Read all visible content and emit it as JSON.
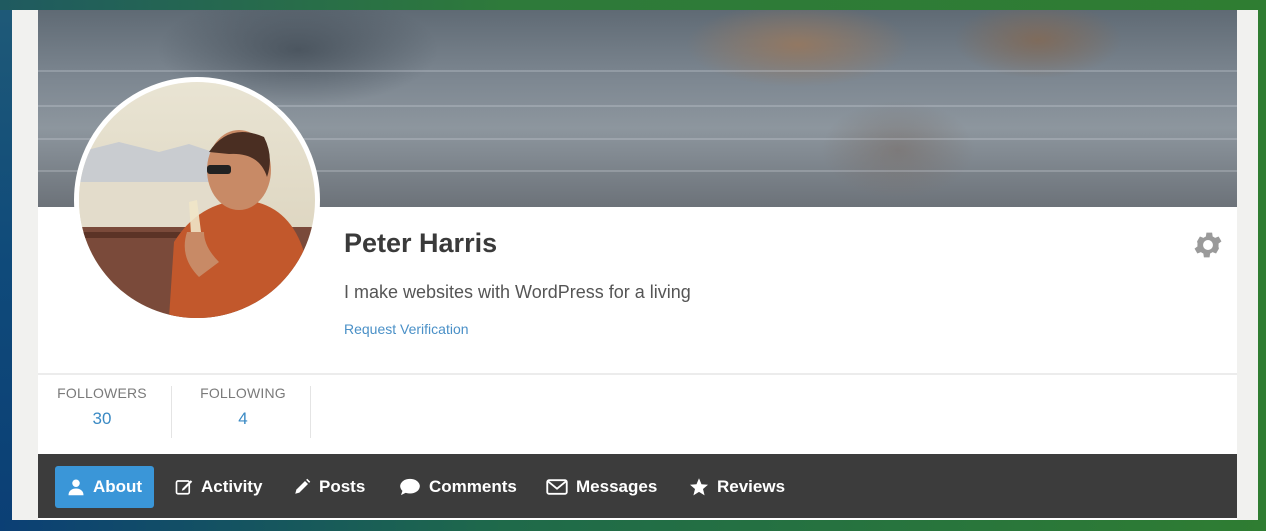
{
  "profile": {
    "name": "Peter Harris",
    "bio": "I make websites with WordPress for a living",
    "verify_link": "Request Verification"
  },
  "stats": [
    {
      "label": "FOLLOWERS",
      "value": "30"
    },
    {
      "label": "FOLLOWING",
      "value": "4"
    }
  ],
  "tabs": [
    {
      "label": "About",
      "icon": "user-icon",
      "active": true
    },
    {
      "label": "Activity",
      "icon": "edit-icon",
      "active": false
    },
    {
      "label": "Posts",
      "icon": "pencil-icon",
      "active": false
    },
    {
      "label": "Comments",
      "icon": "speech-bubble-icon",
      "active": false
    },
    {
      "label": "Messages",
      "icon": "envelope-icon",
      "active": false
    },
    {
      "label": "Reviews",
      "icon": "star-icon",
      "active": false
    }
  ],
  "colors": {
    "accent": "#3a96d8",
    "link": "#4a90c7",
    "navbar": "#3c3c3c"
  }
}
